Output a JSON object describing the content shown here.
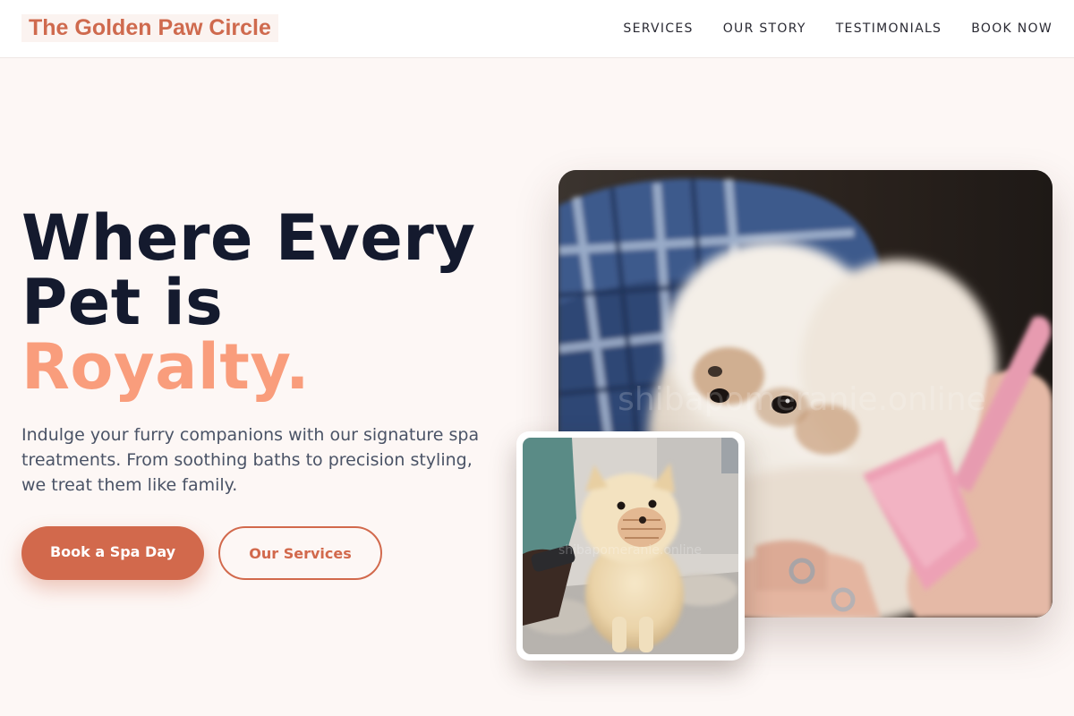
{
  "header": {
    "brand": "The Golden Paw Circle",
    "nav": [
      "SERVICES",
      "OUR STORY",
      "TESTIMONIALS",
      "BOOK NOW"
    ]
  },
  "hero": {
    "title_line1": "Where Every",
    "title_line2": "Pet is",
    "title_accent": "Royalty.",
    "subtitle": "Indulge your furry companions with our signature spa treatments. From soothing baths to precision styling, we treat them like family.",
    "primary_cta": "Book a Spa Day",
    "secondary_cta": "Our Services"
  },
  "images": {
    "main": "fluffy-white-dog-being-brushed",
    "secondary": "pomeranian-with-muzzle-on-grooming-table",
    "main_watermark": "shibapomeranie.online",
    "secondary_watermark": "shibapomeranie.online"
  },
  "colors": {
    "brand": "#cf6a4e",
    "accent": "#f99d7c",
    "heading": "#141a2e",
    "background": "#fdf7f5"
  }
}
